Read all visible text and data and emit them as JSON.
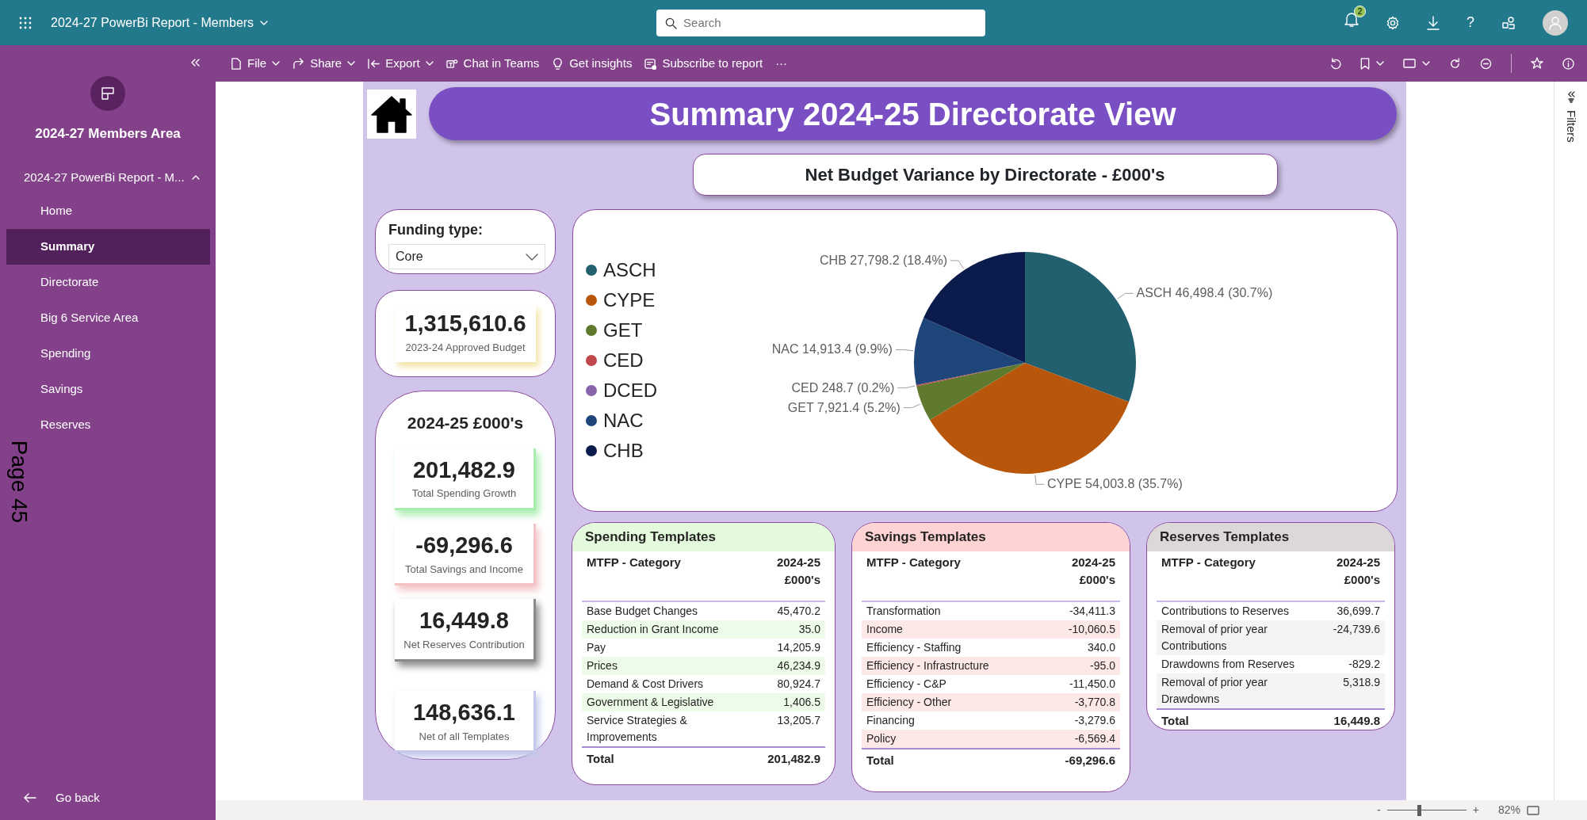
{
  "top_bar": {
    "app_title": "2024-27 PowerBi Report - Members",
    "search": {
      "placeholder": "Search"
    },
    "notification_count": "2",
    "help": "?"
  },
  "toolbar": {
    "items": [
      {
        "label": "File",
        "dropdown": true
      },
      {
        "label": "Share",
        "dropdown": true
      },
      {
        "label": "Export",
        "dropdown": true
      },
      {
        "label": "Chat in Teams",
        "dropdown": false
      },
      {
        "label": "Get insights",
        "dropdown": false
      },
      {
        "label": "Subscribe to report",
        "dropdown": false
      }
    ],
    "more": "···"
  },
  "sidebar": {
    "workspace_title": "2024-27 Members Area",
    "report": {
      "label": "2024-27 PowerBi Report - M...",
      "expanded": true
    },
    "pages": [
      {
        "label": "Home",
        "selected": false
      },
      {
        "label": "Summary",
        "selected": true
      },
      {
        "label": "Directorate",
        "selected": false
      },
      {
        "label": "Big 6 Service Area",
        "selected": false
      },
      {
        "label": "Spending",
        "selected": false
      },
      {
        "label": "Savings",
        "selected": false
      },
      {
        "label": "Reserves",
        "selected": false
      }
    ],
    "go_back": "Go back"
  },
  "page_stamp": "Page 45",
  "report": {
    "title": "Summary 2024-25 Directorate View",
    "chart_title": "Net Budget Variance by Directorate - £000's",
    "funding_slicer": {
      "label": "Funding type:",
      "value": "Core"
    },
    "approved_budget": {
      "value": "1,315,610.6",
      "label": "2023-24 Approved Budget"
    },
    "summary": {
      "heading": "2024-25 £000's",
      "kpis": [
        {
          "value": "201,482.9",
          "label": "Total Spending Growth",
          "color": "#a8ecae"
        },
        {
          "value": "-69,296.6",
          "label": "Total Savings and Income",
          "color": "#f3c3c6"
        },
        {
          "value": "16,449.8",
          "label": "Net Reserves Contribution",
          "color": "#8a8a8a"
        },
        {
          "value": "148,636.1",
          "label": "Net of all Templates",
          "color": "#c3c8ec"
        }
      ]
    },
    "chart_data": {
      "type": "pie",
      "legend": "left",
      "categories": [
        "ASCH",
        "CYPE",
        "GET",
        "CED",
        "DCED",
        "NAC",
        "CHB"
      ],
      "values": [
        46498.4,
        54003.8,
        7921.4,
        248.7,
        0,
        14913.4,
        27798.2
      ],
      "colors": [
        "#22606f",
        "#b8560b",
        "#5f7a2f",
        "#c0474c",
        "#8a64aa",
        "#1f467a",
        "#0b1b4b"
      ],
      "value_labels": [
        "ASCH 46,498.4 (30.7%)",
        "CYPE 54,003.8 (35.7%)",
        "GET 7,921.4 (5.2%)",
        "CED 248.7 (0.2%)",
        null,
        "NAC 14,913.4 (9.9%)",
        "CHB 27,798.2 (18.4%)"
      ]
    },
    "templates": [
      {
        "title": "Spending Templates",
        "color": "#e3fadc",
        "columns": [
          "MTFP - Category",
          "2024-25 £000's"
        ],
        "rows": [
          [
            "Base Budget Changes",
            "45,470.2"
          ],
          [
            "Reduction in Grant Income",
            "35.0"
          ],
          [
            "Pay",
            "14,205.9"
          ],
          [
            "Prices",
            "46,234.9"
          ],
          [
            "Demand & Cost Drivers",
            "80,924.7"
          ],
          [
            "Government & Legislative",
            "1,406.5"
          ],
          [
            "Service Strategies & Improvements",
            "13,205.7"
          ]
        ],
        "total": [
          "Total",
          "201,482.9"
        ]
      },
      {
        "title": "Savings Templates",
        "color": "#fdd3d3",
        "columns": [
          "MTFP - Category",
          "2024-25 £000's"
        ],
        "rows": [
          [
            "Transformation",
            "-34,411.3"
          ],
          [
            "Income",
            "-10,060.5"
          ],
          [
            "Efficiency - Staffing",
            "340.0"
          ],
          [
            "Efficiency - Infrastructure",
            "-95.0"
          ],
          [
            "Efficiency - C&P",
            "-11,450.0"
          ],
          [
            "Efficiency - Other",
            "-3,770.8"
          ],
          [
            "Financing",
            "-3,279.6"
          ],
          [
            "Policy",
            "-6,569.4"
          ]
        ],
        "total": [
          "Total",
          "-69,296.6"
        ]
      },
      {
        "title": "Reserves Templates",
        "color": "#dcd8d8",
        "columns": [
          "MTFP - Category",
          "2024-25 £000's"
        ],
        "rows": [
          [
            "Contributions to Reserves",
            "36,699.7"
          ],
          [
            "Removal of prior year Contributions",
            "-24,739.6"
          ],
          [
            "Drawdowns from Reserves",
            "-829.2"
          ],
          [
            "Removal of prior year Drawdowns",
            "5,318.9"
          ]
        ],
        "total": [
          "Total",
          "16,449.8"
        ]
      }
    ]
  },
  "filters_pane": {
    "label": "Filters"
  },
  "zoom": {
    "minus": "-",
    "plus": "+",
    "level": 0.38,
    "percent": "82%"
  }
}
